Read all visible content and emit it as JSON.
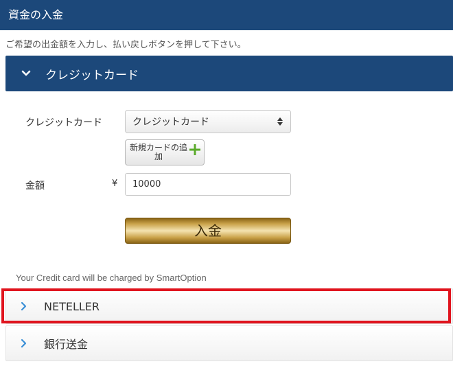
{
  "header": {
    "title": "資金の入金"
  },
  "instruction": "ご希望の出金額を入力し、払い戻しボタンを押して下さい。",
  "sections": [
    {
      "label": "クレジットカード",
      "expanded": true
    },
    {
      "label": "NETELLER",
      "expanded": false,
      "highlighted": true
    },
    {
      "label": "銀行送金",
      "expanded": false
    }
  ],
  "form": {
    "card_label": "クレジットカード",
    "card_select_value": "クレジットカード",
    "add_card_label": "新規カードの追加",
    "amount_label": "金額",
    "currency_symbol": "¥",
    "amount_value": "10000",
    "deposit_label": "入金"
  },
  "charge_note": "Your Credit card will be charged by SmartOption",
  "icons": {
    "open_chevron": "chevron-down-icon",
    "closed_chevron": "chevron-right-icon",
    "add": "plus-icon",
    "select_arrows": "select-arrows-icon"
  },
  "colors": {
    "header_bg": "#1c487a",
    "chevron_blue": "#3a8fd6",
    "plus_green": "#5aaa2a",
    "highlight_red": "#e0141e",
    "gold": "#c9a24a"
  }
}
